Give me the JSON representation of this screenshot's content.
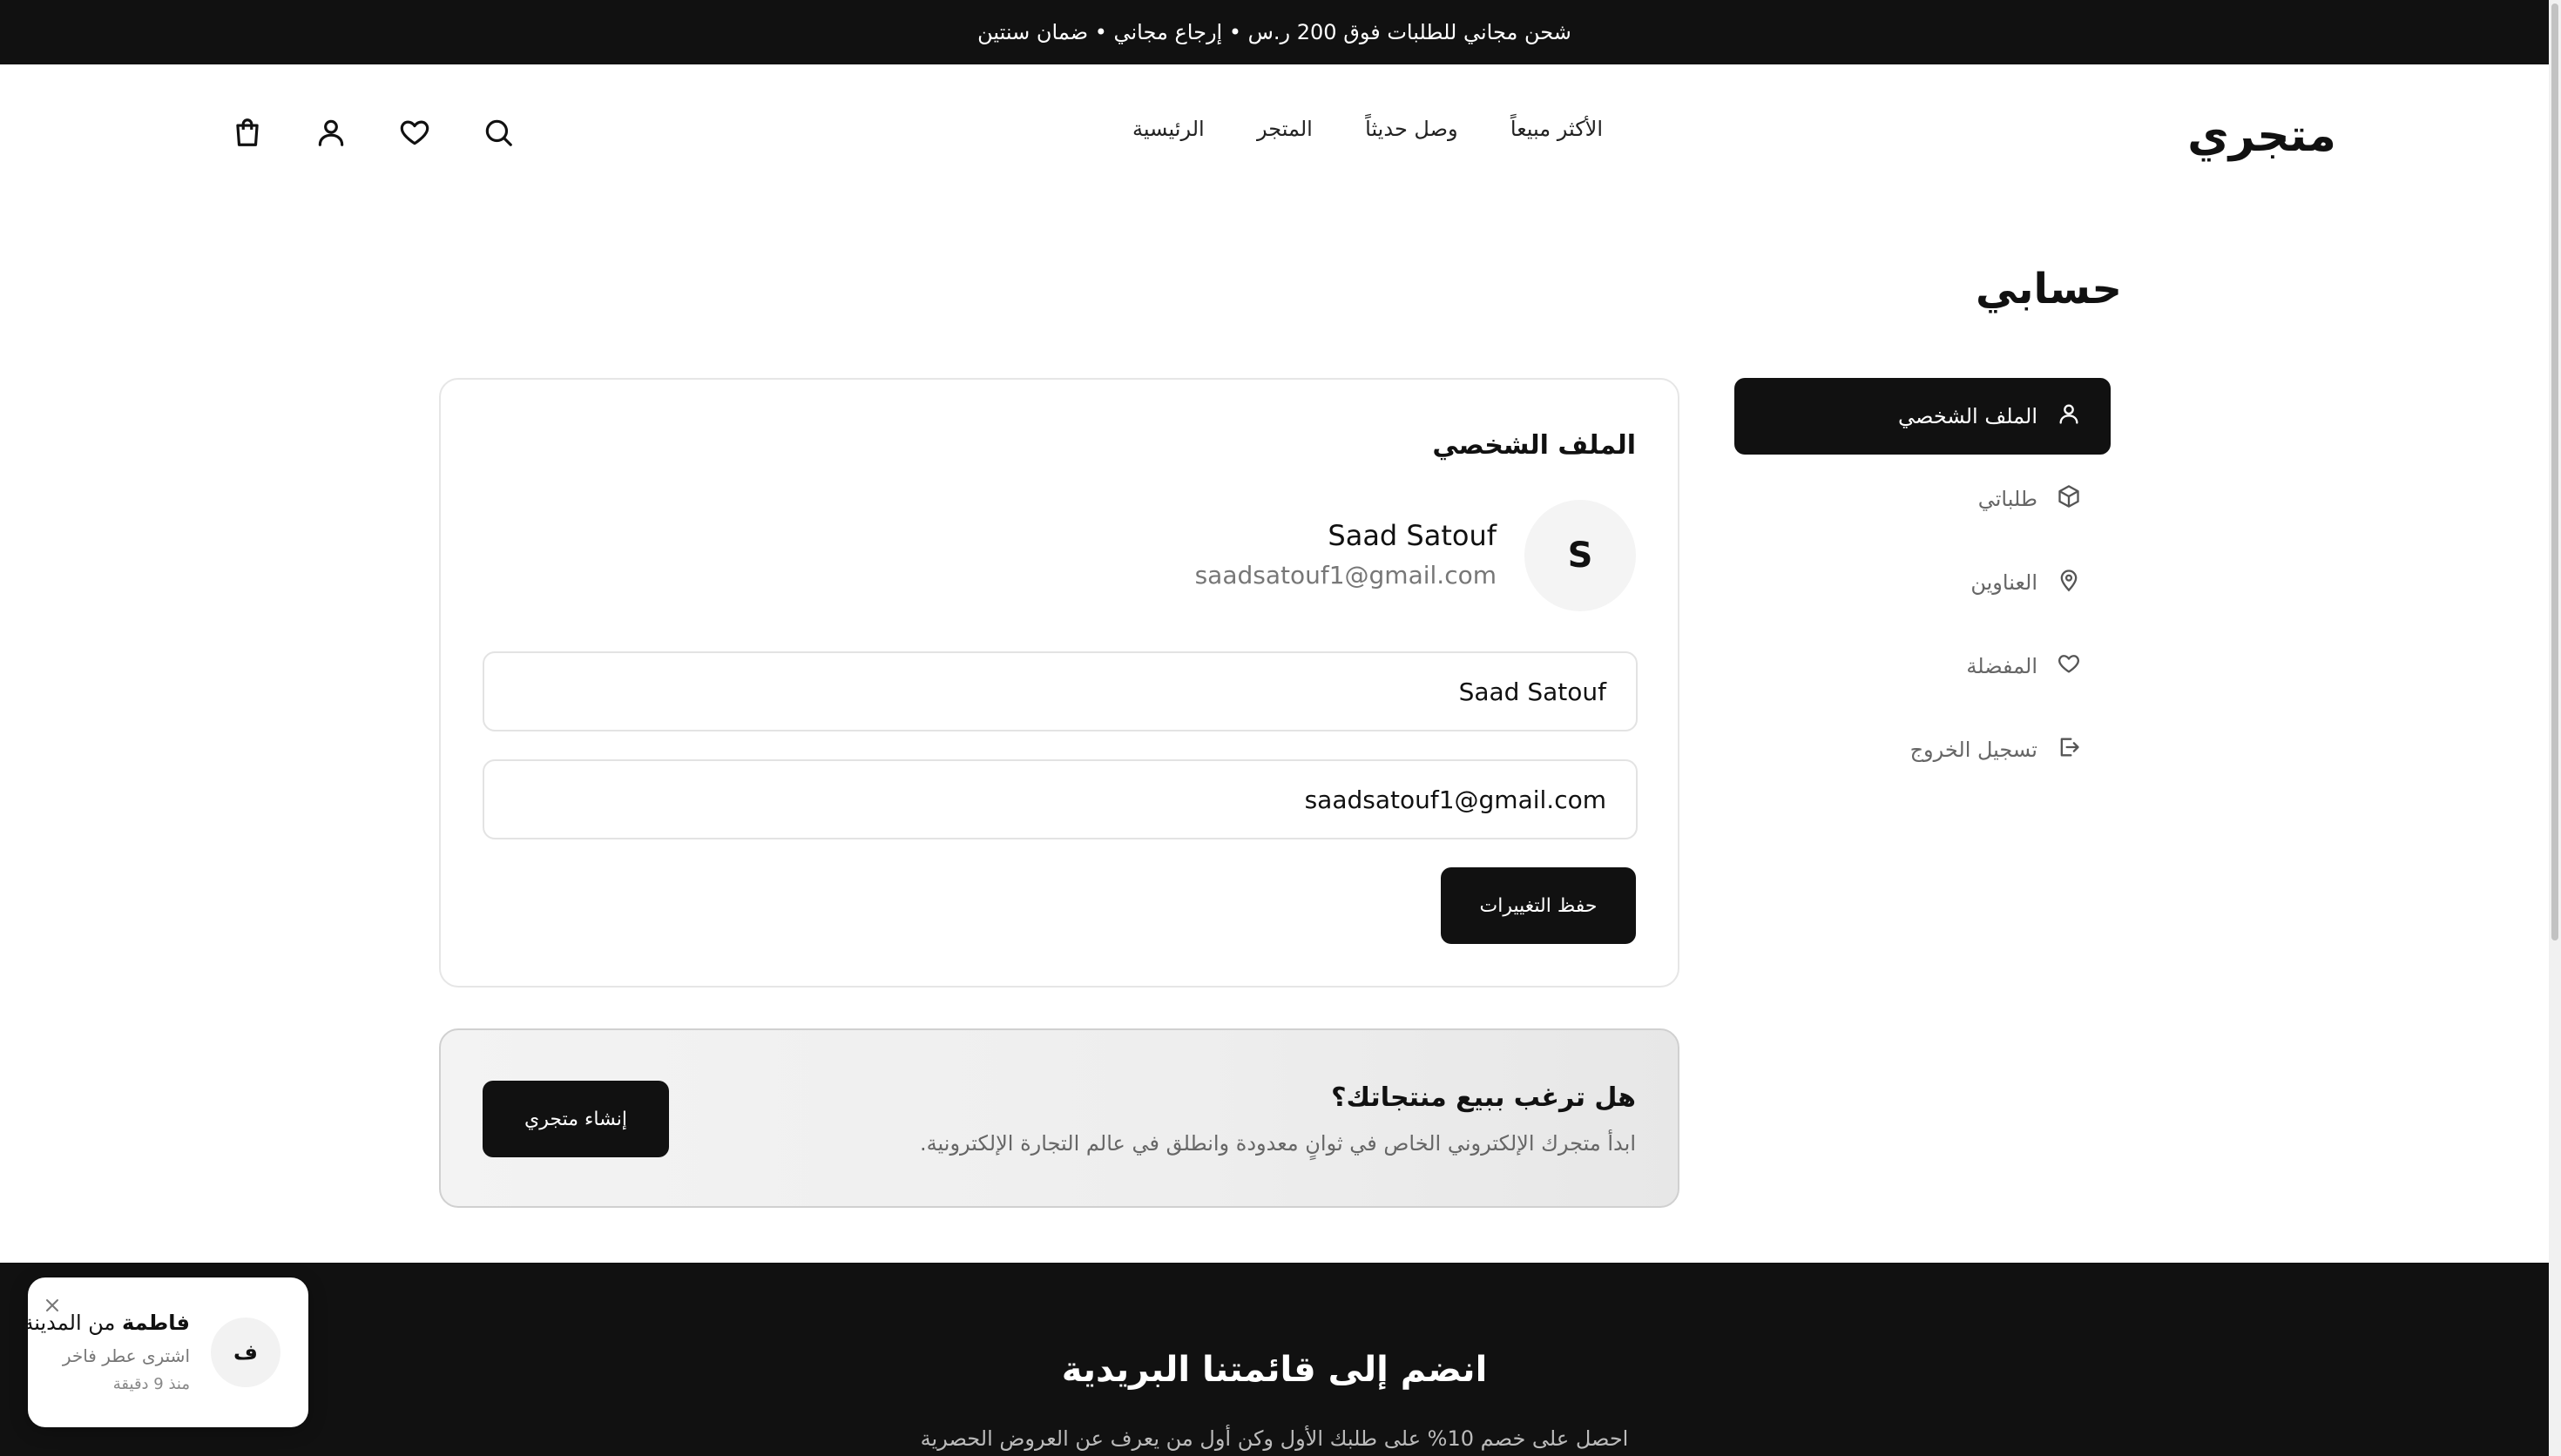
{
  "announcement": "شحن مجاني للطلبات فوق 200 ر.س • إرجاع مجاني • ضمان سنتين",
  "header": {
    "logo": "متجري",
    "nav": [
      "الرئيسية",
      "المتجر",
      "وصل حديثاً",
      "الأكثر مبيعاً"
    ],
    "icons": [
      "search-icon",
      "heart-icon",
      "user-icon",
      "shopping-bag-icon"
    ]
  },
  "page": {
    "title": "حسابي"
  },
  "sidebar": {
    "items": [
      {
        "label": "الملف الشخصي",
        "icon": "user-icon",
        "active": true
      },
      {
        "label": "طلباتي",
        "icon": "box-icon"
      },
      {
        "label": "العناوين",
        "icon": "map-pin-icon"
      },
      {
        "label": "المفضلة",
        "icon": "heart-icon"
      },
      {
        "label": "تسجيل الخروج",
        "icon": "logout-icon"
      }
    ]
  },
  "profile": {
    "title": "الملف الشخصي",
    "avatar_initial": "S",
    "name": "Saad Satouf",
    "email": "saadsatouf1@gmail.com",
    "name_field_value": "Saad Satouf",
    "email_field_value": "saadsatouf1@gmail.com",
    "save_label": "حفظ التغييرات"
  },
  "seller": {
    "title": "هل ترغب ببيع منتجاتك؟",
    "subtitle": "ابدأ متجرك الإلكتروني الخاص في ثوانٍ معدودة وانطلق في عالم التجارة الإلكترونية.",
    "button_label": "إنشاء متجري"
  },
  "newsletter": {
    "title": "انضم إلى قائمتنا البريدية",
    "subtitle": "احصل على خصم 10% على طلبك الأول وكن أول من يعرف عن العروض الحصرية"
  },
  "toast": {
    "avatar_initial": "ف",
    "name": "فاطمة",
    "location": "من المدينة",
    "action": "اشترى عطر فاخر",
    "time": "منذ 9 دقيقة"
  }
}
